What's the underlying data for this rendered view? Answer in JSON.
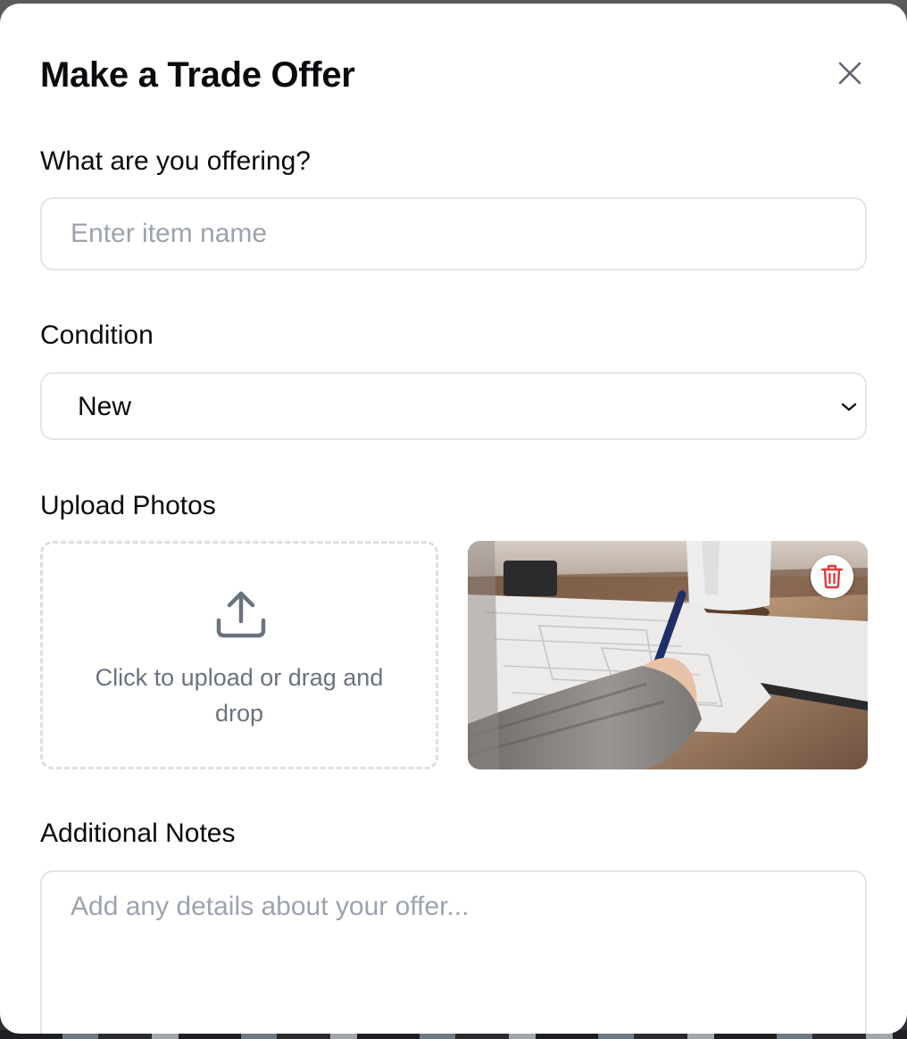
{
  "modal": {
    "title": "Make a Trade Offer",
    "close_icon": "close-icon"
  },
  "form": {
    "item_label": "What are you offering?",
    "item_placeholder": "Enter item name",
    "item_value": "",
    "condition_label": "Condition",
    "condition_selected": "New",
    "photos_label": "Upload Photos",
    "dropzone_text": "Click to upload or drag and drop",
    "upload_icon": "upload-icon",
    "delete_icon": "trash-icon",
    "notes_label": "Additional Notes",
    "notes_placeholder": "Add any details about your offer...",
    "notes_value": ""
  },
  "colors": {
    "label": "#0b0b0f",
    "placeholder": "#9ca3ae",
    "border": "#e3e5e8",
    "muted_text": "#6b7280",
    "delete_red": "#e0393e"
  }
}
